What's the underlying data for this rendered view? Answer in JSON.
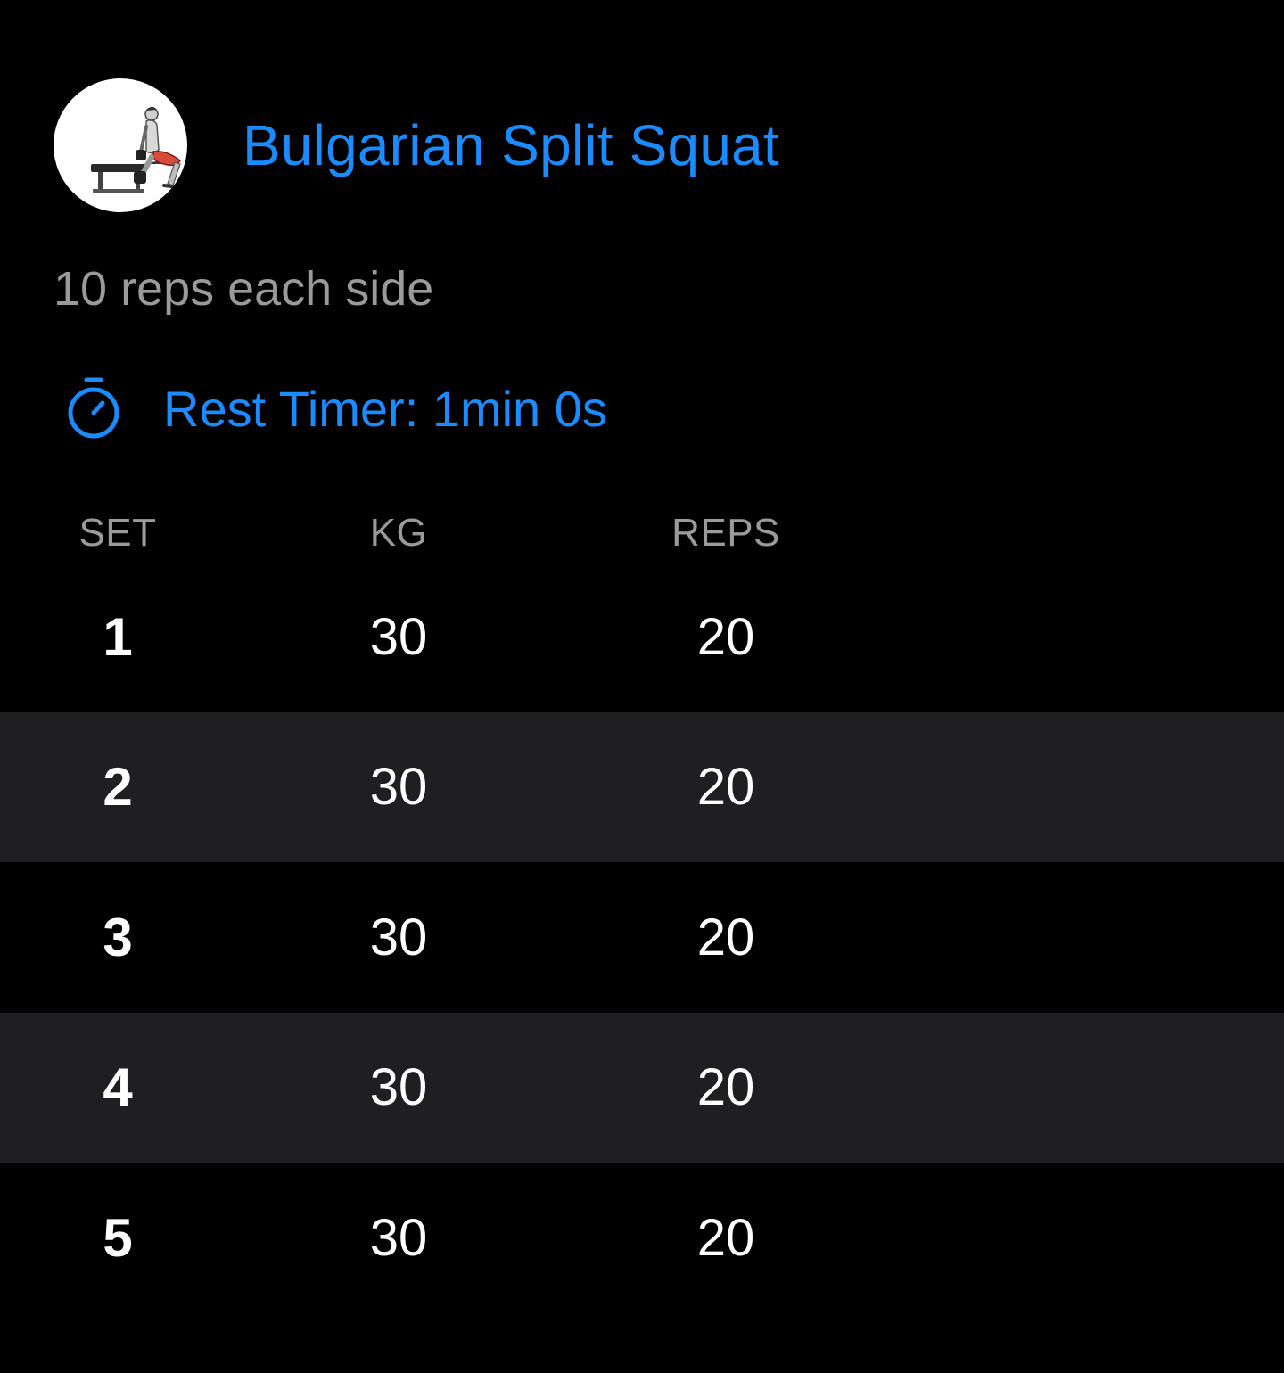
{
  "exercise": {
    "title": "Bulgarian Split Squat",
    "notes": "10 reps each side",
    "thumbnail_icon": "exercise-thumbnail",
    "accent_color": "#1a8cff"
  },
  "rest_timer": {
    "icon": "stopwatch-icon",
    "label": "Rest Timer: 1min 0s"
  },
  "table": {
    "headers": {
      "set": "SET",
      "kg": "KG",
      "reps": "REPS"
    },
    "rows": [
      {
        "set": "1",
        "kg": "30",
        "reps": "20"
      },
      {
        "set": "2",
        "kg": "30",
        "reps": "20"
      },
      {
        "set": "3",
        "kg": "30",
        "reps": "20"
      },
      {
        "set": "4",
        "kg": "30",
        "reps": "20"
      },
      {
        "set": "5",
        "kg": "30",
        "reps": "20"
      }
    ]
  }
}
